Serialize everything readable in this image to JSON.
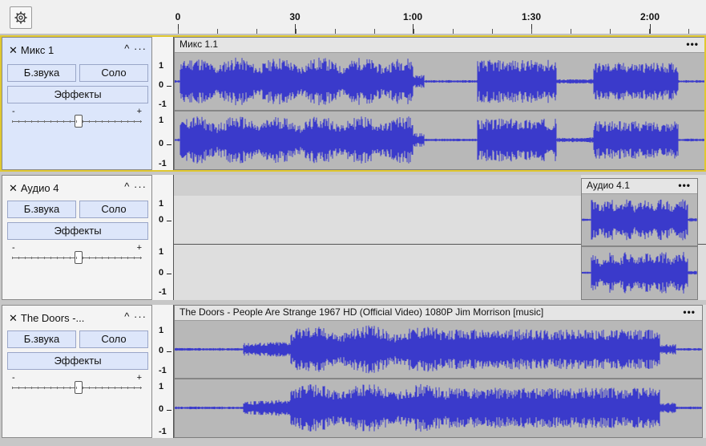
{
  "toolbar": {
    "settings_icon": "gear-icon"
  },
  "ruler": {
    "labels": [
      "0",
      "30",
      "1:00",
      "1:30",
      "2:00"
    ]
  },
  "tracks": [
    {
      "name": "Микс 1",
      "mute_label": "Б.звука",
      "solo_label": "Соло",
      "effects_label": "Эффекты",
      "collapse_icon": "^",
      "menu_icon": "···",
      "clip_name": "Микс 1.1",
      "clip_menu": "•••",
      "scale_labels": [
        "1",
        "0",
        "-1",
        "1",
        "0",
        "-1"
      ],
      "pan": "0"
    },
    {
      "name": "Аудио 4",
      "mute_label": "Б.звука",
      "solo_label": "Соло",
      "effects_label": "Эффекты",
      "collapse_icon": "^",
      "menu_icon": "···",
      "clip_name": "Аудио 4.1",
      "clip_menu": "•••",
      "scale_labels": [
        "1",
        "0",
        "1",
        "0",
        "-1"
      ],
      "pan": "0"
    },
    {
      "name": "The Doors -...",
      "mute_label": "Б.звука",
      "solo_label": "Соло",
      "effects_label": "Эффекты",
      "collapse_icon": "^",
      "menu_icon": "···",
      "clip_name": "The Doors - People Are Strange 1967 HD (Official Video) 1080P Jim Morrison [music]",
      "clip_menu": "•••",
      "scale_labels": [
        "1",
        "0",
        "-1",
        "1",
        "0",
        "-1"
      ],
      "pan": "0"
    }
  ],
  "slider": {
    "minus": "-",
    "plus": "+"
  },
  "colors": {
    "waveform": "#3a3acb",
    "selected_panel": "#dce6fb",
    "selection_border": "#e0c830"
  }
}
